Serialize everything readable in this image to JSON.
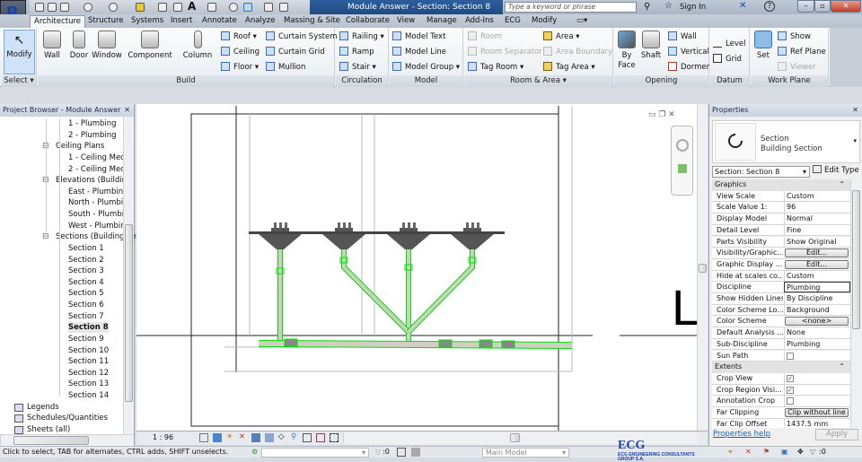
{
  "app": {
    "logo": "R",
    "title": "Module Answer - Section: Section 8",
    "search_placeholder": "Type a keyword or phrase",
    "sign_in": "Sign In",
    "help": "?"
  },
  "tabs": [
    "Architecture",
    "Structure",
    "Systems",
    "Insert",
    "Annotate",
    "Analyze",
    "Massing & Site",
    "Collaborate",
    "View",
    "Manage",
    "Add-Ins",
    "ECG",
    "Modify"
  ],
  "ribbon": {
    "select": {
      "modify": "Modify",
      "label": "Select ▾"
    },
    "build": {
      "label": "Build",
      "wall": "Wall",
      "door": "Door",
      "window": "Window",
      "component": "Component",
      "column": "Column",
      "roof": "Roof",
      "ceiling": "Ceiling",
      "floor": "Floor",
      "curtain_system": "Curtain System",
      "curtain_grid": "Curtain Grid",
      "mullion": "Mullion"
    },
    "circulation": {
      "label": "Circulation",
      "railing": "Railing",
      "ramp": "Ramp",
      "stair": "Stair"
    },
    "model": {
      "label": "Model",
      "text": "Model Text",
      "line": "Model Line",
      "group": "Model Group"
    },
    "room_area": {
      "label": "Room & Area ▾",
      "room": "Room",
      "room_separator": "Room Separator",
      "tag_room": "Tag Room",
      "area": "Area",
      "area_boundary": "Area Boundary",
      "tag_area": "Tag Area"
    },
    "opening": {
      "label": "Opening",
      "by_face": "By Face",
      "shaft": "Shaft",
      "wall": "Wall",
      "vertical": "Vertical",
      "dormer": "Dormer"
    },
    "datum": {
      "label": "Datum",
      "level": "Level",
      "grid": "Grid"
    },
    "work_plane": {
      "label": "Work Plane",
      "set": "Set",
      "show": "Show",
      "ref_plane": "Ref Plane",
      "viewer": "Viewer"
    }
  },
  "project_browser": {
    "title": "Project Browser - Module Answer",
    "items": [
      {
        "label": "1 - Plumbing",
        "level": 3
      },
      {
        "label": "2 - Plumbing",
        "level": 3
      },
      {
        "label": "Ceiling Plans",
        "level": 2
      },
      {
        "label": "1 - Ceiling Mecl",
        "level": 3
      },
      {
        "label": "2 - Ceiling Mecl",
        "level": 3
      },
      {
        "label": "Elevations (Building",
        "level": 2
      },
      {
        "label": "East - Plumbing",
        "level": 3
      },
      {
        "label": "North - Plumbin",
        "level": 3
      },
      {
        "label": "South - Plumbin",
        "level": 3
      },
      {
        "label": "West - Plumbing",
        "level": 3
      },
      {
        "label": "Sections (Building Se",
        "level": 2
      },
      {
        "label": "Section 1",
        "level": 3
      },
      {
        "label": "Section 2",
        "level": 3
      },
      {
        "label": "Section 3",
        "level": 3
      },
      {
        "label": "Section 4",
        "level": 3
      },
      {
        "label": "Section 5",
        "level": 3
      },
      {
        "label": "Section 6",
        "level": 3
      },
      {
        "label": "Section 7",
        "level": 3
      },
      {
        "label": "Section 8",
        "level": 3,
        "selected": true
      },
      {
        "label": "Section 9",
        "level": 3
      },
      {
        "label": "Section 10",
        "level": 3
      },
      {
        "label": "Section 11",
        "level": 3
      },
      {
        "label": "Section 12",
        "level": 3
      },
      {
        "label": "Section 13",
        "level": 3
      },
      {
        "label": "Section 14",
        "level": 3
      },
      {
        "label": "Legends",
        "level": 1
      },
      {
        "label": "Schedules/Quantities",
        "level": 1
      },
      {
        "label": "Sheets (all)",
        "level": 1
      }
    ]
  },
  "view": {
    "scale": "1 : 96",
    "level_label": "L",
    "pipe_color": "#00e000"
  },
  "properties": {
    "title": "Properties",
    "type_name": "Section",
    "type_sub": "Building Section",
    "instance": "Section: Section 8",
    "edit_type": "Edit Type",
    "groups": [
      {
        "name": "Graphics",
        "rows": [
          {
            "k": "View Scale",
            "v": "Custom"
          },
          {
            "k": "Scale Value    1:",
            "v": "96"
          },
          {
            "k": "Display Model",
            "v": "Normal"
          },
          {
            "k": "Detail Level",
            "v": "Fine"
          },
          {
            "k": "Parts Visibility",
            "v": "Show Original"
          },
          {
            "k": "Visibility/Graphic...",
            "btn": "Edit..."
          },
          {
            "k": "Graphic Display ...",
            "btn": "Edit..."
          },
          {
            "k": "Hide at scales co...",
            "v": "Custom"
          },
          {
            "k": "Discipline",
            "v": "Plumbing"
          },
          {
            "k": "Show Hidden Lines",
            "v": "By Discipline"
          },
          {
            "k": "Color Scheme Lo...",
            "v": "Background"
          },
          {
            "k": "Color Scheme",
            "btn": "<none>"
          },
          {
            "k": "Default Analysis ...",
            "v": "None"
          },
          {
            "k": "Sub-Discipline",
            "v": "Plumbing"
          },
          {
            "k": "Sun Path",
            "chk": false
          }
        ]
      },
      {
        "name": "Extents",
        "rows": [
          {
            "k": "Crop View",
            "chk": true
          },
          {
            "k": "Crop Region Visi...",
            "chk": true
          },
          {
            "k": "Annotation Crop",
            "chk": false
          },
          {
            "k": "Far Clipping",
            "btn": "Clip without line"
          },
          {
            "k": "Far Clip Offset",
            "v": "1437.5 mm"
          }
        ]
      }
    ],
    "help": "Properties help",
    "apply": "Apply"
  },
  "status": {
    "message": "Click to select, TAB for alternates, CTRL adds, SHIFT unselects.",
    "filter_count": ":0",
    "model": "Main Model",
    "selection_count": ":0",
    "logo": "ECG ENGINEERING CONSULTANTS GROUP S.A."
  }
}
